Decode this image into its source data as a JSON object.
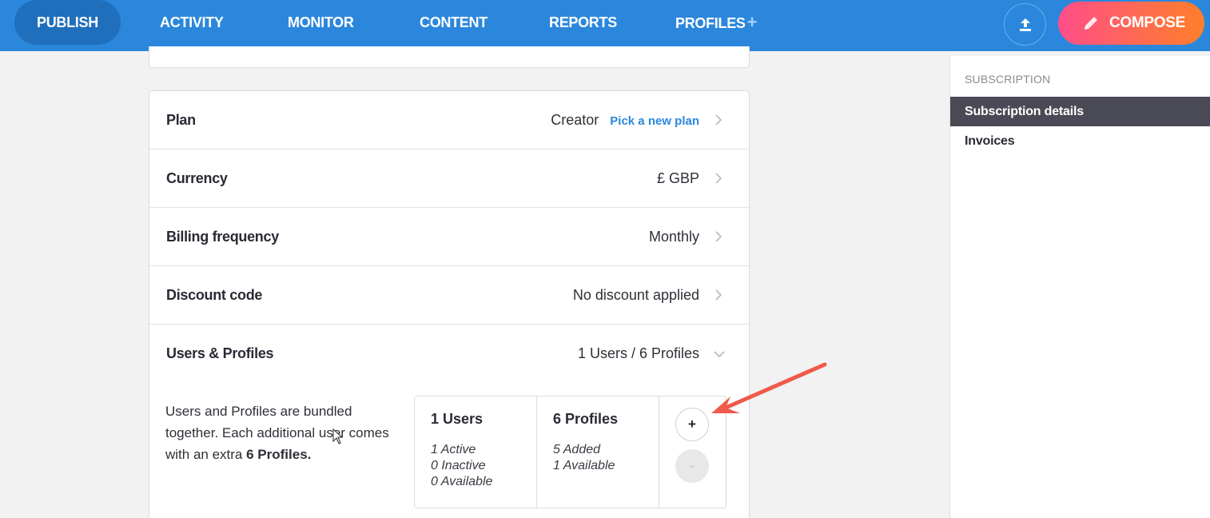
{
  "nav": {
    "items": [
      {
        "label": "PUBLISH",
        "active": true
      },
      {
        "label": "ACTIVITY",
        "active": false
      },
      {
        "label": "MONITOR",
        "active": false
      },
      {
        "label": "CONTENT",
        "active": false
      },
      {
        "label": "REPORTS",
        "active": false
      },
      {
        "label": "PROFILES",
        "active": false
      }
    ],
    "profiles_plus": "+",
    "upload_icon": "upload-icon",
    "compose_label": "COMPOSE",
    "compose_icon": "pencil-icon"
  },
  "subscription": {
    "rows": [
      {
        "label": "Plan",
        "value": "Creator",
        "link": "Pick a new plan"
      },
      {
        "label": "Currency",
        "value": "£ GBP"
      },
      {
        "label": "Billing frequency",
        "value": "Monthly"
      },
      {
        "label": "Discount code",
        "value": "No discount applied"
      },
      {
        "label": "Users & Profiles",
        "value": "1 Users / 6 Profiles"
      }
    ],
    "users_desc_text": "Users and Profiles are bundled together. Each additional user comes with an extra",
    "users_desc_bold": "6 Profiles.",
    "users": {
      "title": "1 Users",
      "lines": [
        "1 Active",
        "0 Inactive",
        "0 Available"
      ]
    },
    "profiles": {
      "title": "6 Profiles",
      "lines": [
        "5 Added",
        "1 Available"
      ]
    },
    "add_label": "+",
    "remove_label": "-"
  },
  "sidebar": {
    "heading": "SUBSCRIPTION",
    "items": [
      {
        "label": "Subscription details",
        "active": true
      },
      {
        "label": "Invoices",
        "active": false
      }
    ]
  },
  "colors": {
    "nav_bg": "#2b87dc",
    "nav_active": "#1f6fbc",
    "compose_gradient_start": "#ff4d8a",
    "compose_gradient_end": "#ff7e2a",
    "link": "#2b87dc",
    "annotation_arrow": "#ef5a4b",
    "sidebar_active_bg": "#4a4a56"
  }
}
